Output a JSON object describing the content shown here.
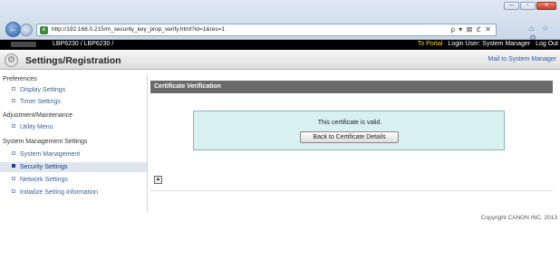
{
  "browser": {
    "window_controls": [
      "—",
      "▫",
      "✕"
    ],
    "address_url": "http://192.168.0.215/m_security_key_prop_verify.html?id=1&res=1",
    "address_tools": "ρ ▾ ⊠ ℭ ✕",
    "toolbar_icons": "⌂ ☆ ⚙"
  },
  "product_bar": {
    "product_name": "LBP6230 / LBP6230 /",
    "portal_link": "To Portal",
    "login_user": "Login User: System Manager",
    "logout_link": "Log Out"
  },
  "header": {
    "title": "Settings/Registration",
    "mail_link": "Mail to System Manager"
  },
  "sidebar": {
    "items": [
      {
        "label": "Preferences",
        "type": "heading"
      },
      {
        "label": "Display Settings",
        "type": "link"
      },
      {
        "label": "Timer Settings",
        "type": "link"
      },
      {
        "label": "Adjustment/Maintenance",
        "type": "heading"
      },
      {
        "label": "Utility Menu",
        "type": "link"
      },
      {
        "label": "System Management Settings",
        "type": "heading"
      },
      {
        "label": "System Management",
        "type": "link"
      },
      {
        "label": "Security Settings",
        "type": "link",
        "active": true
      },
      {
        "label": "Network Settings",
        "type": "link"
      },
      {
        "label": "Initialize Setting Information",
        "type": "link"
      }
    ]
  },
  "main": {
    "section_title": "Certificate Verification",
    "message": "This certificate is valid.",
    "back_button": "Back to Certificate Details",
    "page_top_icon": "▲"
  },
  "footer": {
    "copyright": "Copyright CANON INC. 2013"
  }
}
